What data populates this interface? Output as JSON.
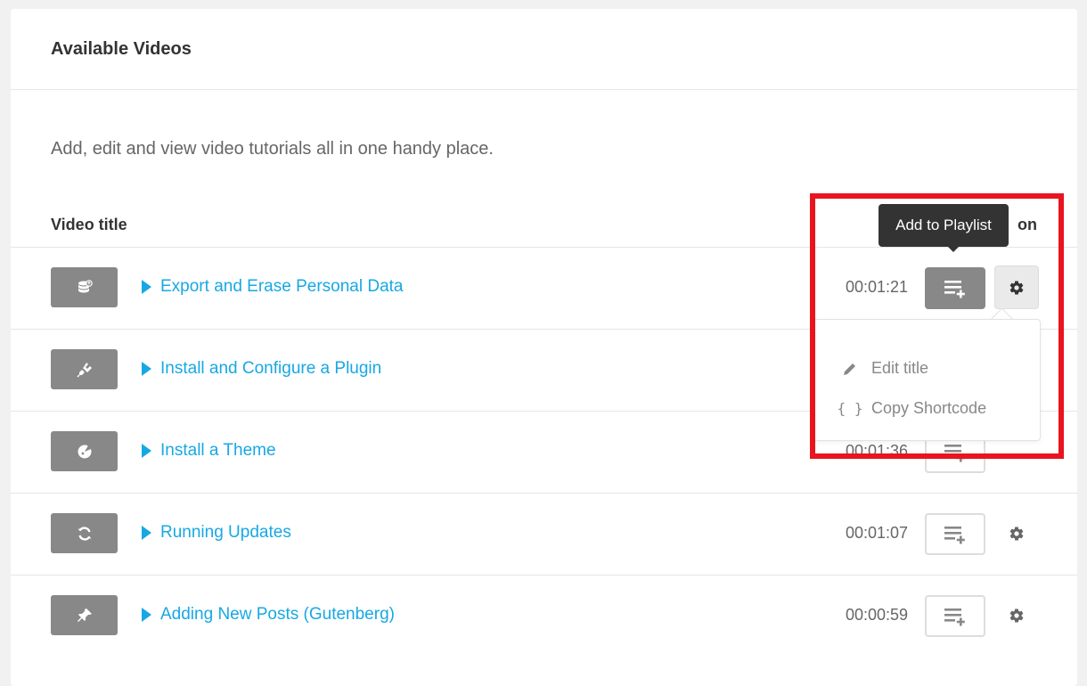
{
  "panel": {
    "title": "Available Videos",
    "description": "Add, edit and view video tutorials all in one handy place."
  },
  "table": {
    "col_title": "Video title",
    "col_action": "on"
  },
  "videos": [
    {
      "title": "Export and Erase Personal Data",
      "duration": "00:01:21",
      "icon": "database-export-icon"
    },
    {
      "title": "Install and Configure a Plugin",
      "duration": "",
      "icon": "plugin-icon"
    },
    {
      "title": "Install a Theme",
      "duration": "00:01:36",
      "icon": "theme-palette-icon"
    },
    {
      "title": "Running Updates",
      "duration": "00:01:07",
      "icon": "refresh-icon"
    },
    {
      "title": "Adding New Posts (Gutenberg)",
      "duration": "00:00:59",
      "icon": "pin-icon"
    }
  ],
  "tooltip": {
    "text": "Add to Playlist"
  },
  "dropdown": {
    "items": [
      {
        "label": "Edit title",
        "icon": "pencil-icon"
      },
      {
        "label": "Copy Shortcode",
        "icon": "braces-icon"
      }
    ]
  },
  "colors": {
    "link": "#17a8e3",
    "highlight": "#e8141e",
    "thumb": "#888888"
  }
}
